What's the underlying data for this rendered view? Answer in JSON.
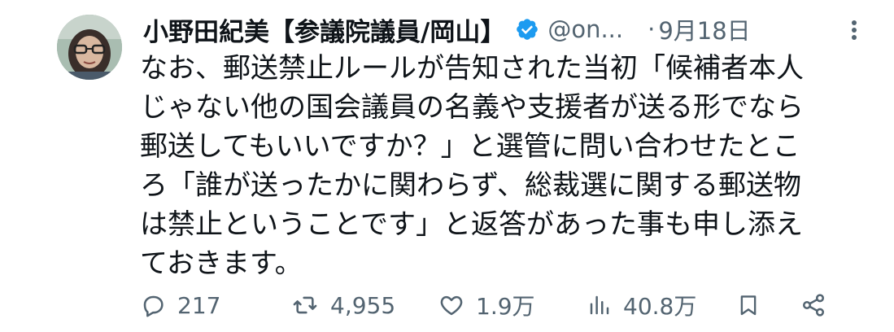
{
  "tweet": {
    "author": {
      "display_name": "小野田紀美【参議院議員/岡山】",
      "handle": "@on...",
      "verified": true
    },
    "separator": "·",
    "date": "9月18日",
    "text_lines": [
      "なお、郵送禁止ルールが告知された当初「候補者本人",
      "じゃない他の国会議員の名義や支援者が送る形でなら",
      "郵送してもいいですか？」と選管に問い合わせたとこ",
      "ろ「誰が送ったかに関わらず、総裁選に関する郵送物",
      "は禁止ということです」と返答があった事も申し添え",
      "ておきます。"
    ],
    "stats": {
      "replies": "217",
      "retweets": "4,955",
      "likes": "1.9万",
      "views": "40.8万"
    }
  },
  "icons": {
    "verified": "verified-badge-icon",
    "more": "more-options-icon",
    "reply": "reply-icon",
    "retweet": "retweet-icon",
    "like": "heart-icon",
    "views": "views-bar-chart-icon",
    "bookmark": "bookmark-icon",
    "share": "share-icon"
  },
  "colors": {
    "text": "#0f1419",
    "secondary": "#536471",
    "verified": "#1d9bf0",
    "background": "#ffffff"
  }
}
